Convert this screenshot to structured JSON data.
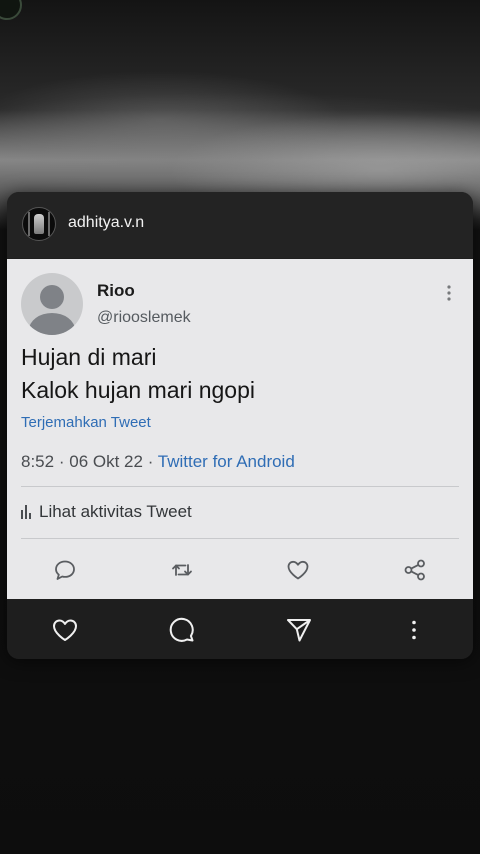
{
  "post": {
    "username": "adhitya.v.n",
    "avatar_icon": "profile-photo-icon"
  },
  "tweet": {
    "name": "Rioo",
    "handle": "@riooslemek",
    "more_icon": "vertical-dots-icon",
    "lines": [
      "Hujan di mari",
      "Kalok hujan mari ngopi"
    ],
    "translate_label": "Terjemahkan Tweet",
    "time": "8:52",
    "date": "06 Okt 22",
    "separator": "·",
    "source": "Twitter for Android",
    "activity_label": "Lihat aktivitas Tweet",
    "actions": [
      "reply-icon",
      "retweet-icon",
      "like-icon",
      "share-icon"
    ]
  },
  "bottom_bar": {
    "icons": [
      "heart-icon",
      "comment-icon",
      "send-icon",
      "more-vertical-icon"
    ]
  },
  "colors": {
    "link_blue": "#2f6db5",
    "tweet_bg": "#e8e8ea",
    "post_bg": "#1f1f1f"
  }
}
